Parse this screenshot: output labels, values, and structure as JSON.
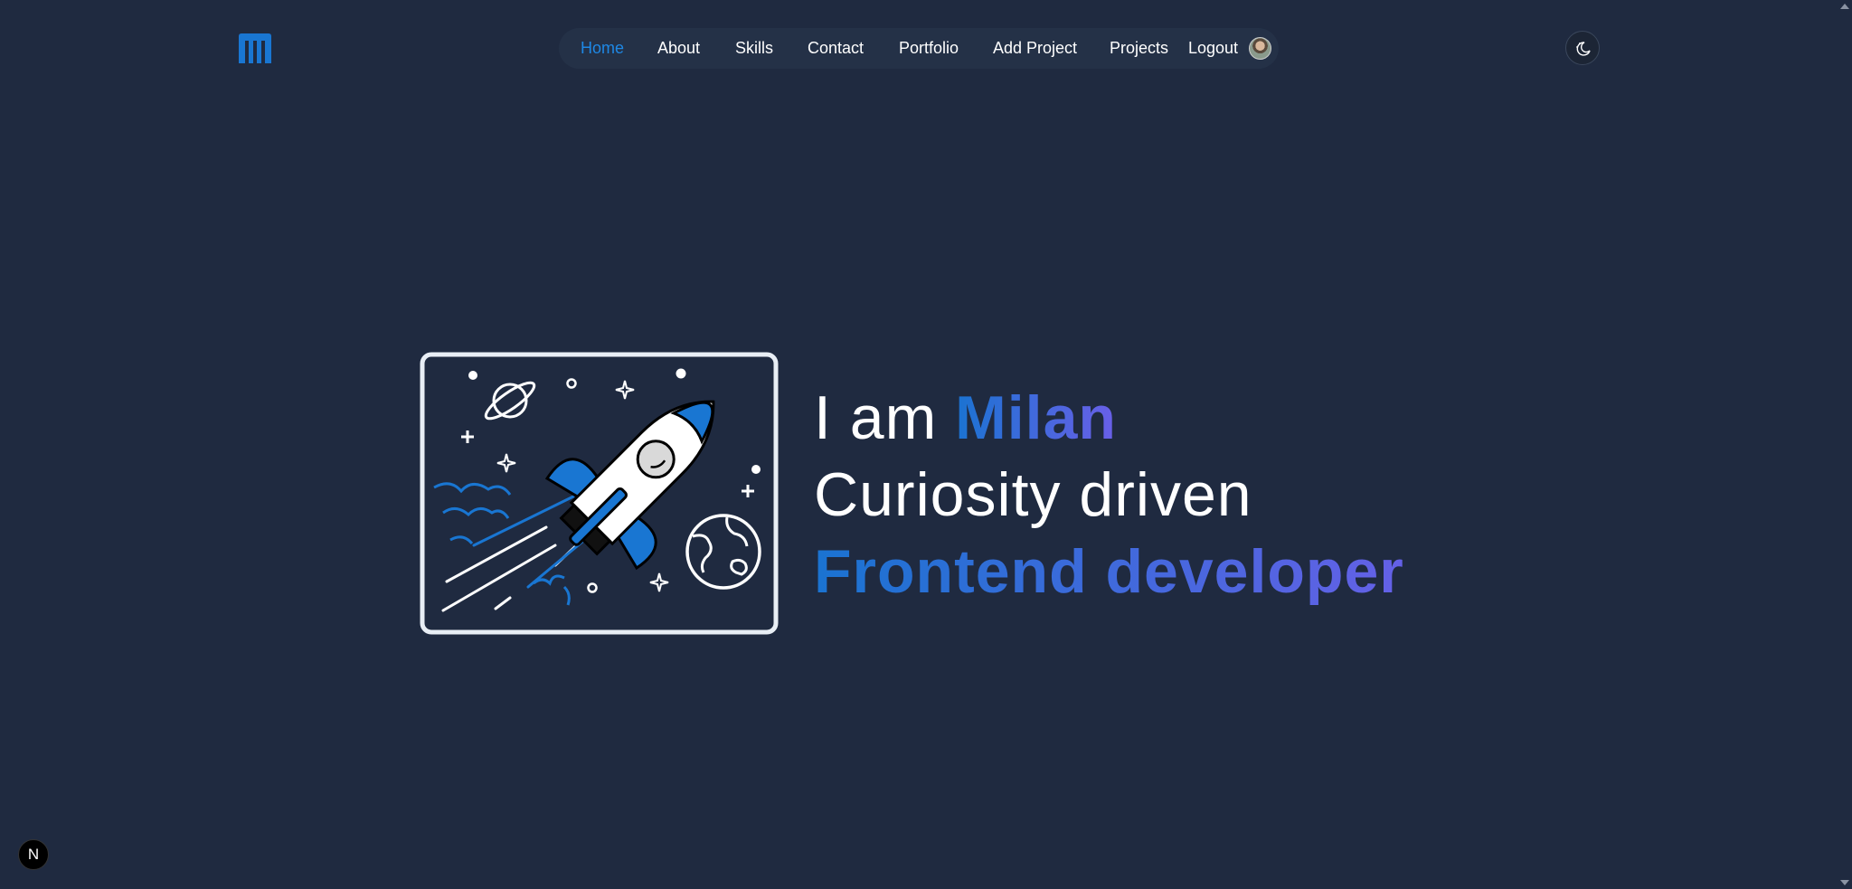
{
  "header": {
    "logo_icon": "m-logo-icon",
    "logo_color": "#1976d2"
  },
  "nav": {
    "items": [
      {
        "label": "Home",
        "active": true
      },
      {
        "label": "About",
        "active": false
      },
      {
        "label": "Skills",
        "active": false
      },
      {
        "label": "Contact",
        "active": false
      },
      {
        "label": "Portfolio",
        "active": false
      },
      {
        "label": "Add Project",
        "active": false
      },
      {
        "label": "Projects",
        "active": false
      },
      {
        "label": "Logout",
        "active": false
      }
    ],
    "active_color": "#1e88e5",
    "avatar_icon": "user-avatar"
  },
  "theme_toggle": {
    "icon": "moon-sun-icon"
  },
  "hero": {
    "illustration_icon": "rocket-illustration",
    "line1_prefix": "I am ",
    "line1_name": "Milan",
    "line2": "Curiosity driven",
    "line3": "Frontend developer",
    "gradient_start": "#1a73d1",
    "gradient_end": "#6a5fe8"
  },
  "badge": {
    "label": "N",
    "icon": "nextjs-icon"
  }
}
